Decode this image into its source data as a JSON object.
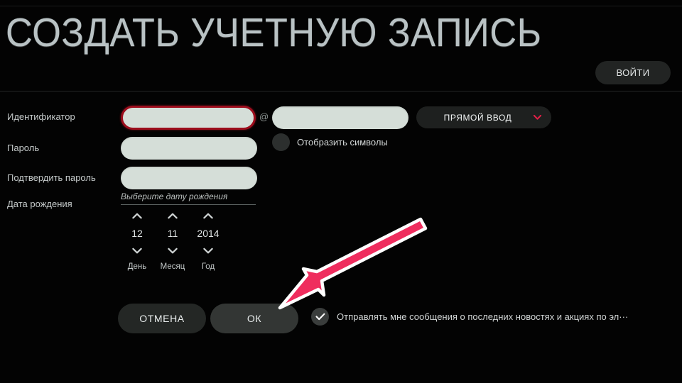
{
  "page": {
    "title": "СОЗДАТЬ УЧЕТНУЮ ЗАПИСЬ",
    "login_button": "ВОЙТИ"
  },
  "colors": {
    "background": "#030303",
    "title_text": "#b9c2c4",
    "label_text": "#c6cbcb",
    "input_fill": "#d5ded8",
    "error_border": "#9c0d1c",
    "accent_chevron": "#e01f46",
    "button_fill": "#242725",
    "button_fill_focused": "#333634",
    "pointer_arrow": "#ef2d5e",
    "pointer_arrow_outline": "#ffffff"
  },
  "form": {
    "identifier": {
      "label": "Идентификатор",
      "value": "",
      "placeholder": "",
      "at_symbol": "@",
      "domain_value": "",
      "domain_placeholder": "",
      "entry_mode": "ПРЯМОЙ ВВОД",
      "chevron_icon": "chevron-down-icon"
    },
    "password": {
      "label": "Пароль",
      "value": "",
      "placeholder": ""
    },
    "confirm_password": {
      "label": "Подтвердить пароль",
      "value": "",
      "placeholder": ""
    },
    "show_characters": {
      "label": "Отобразить символы",
      "checked": false
    },
    "date_of_birth": {
      "label": "Дата рождения",
      "hint": "Выберите дату рождения",
      "up_icon": "chevron-up-icon",
      "down_icon": "chevron-down-icon",
      "spinners": [
        {
          "value": "12",
          "name": "День"
        },
        {
          "value": "11",
          "name": "Месяц"
        },
        {
          "value": "2014",
          "name": "Год"
        }
      ]
    }
  },
  "actions": {
    "cancel": "ОТМЕНА",
    "ok": "ОК",
    "newsletter": {
      "label": "Отправлять мне сообщения о последних новостях и акциях по эл···",
      "checked": true,
      "check_icon": "check-icon"
    }
  },
  "annotation": {
    "pointer": "arrow-pointer-icon",
    "points_at": "ОК"
  }
}
